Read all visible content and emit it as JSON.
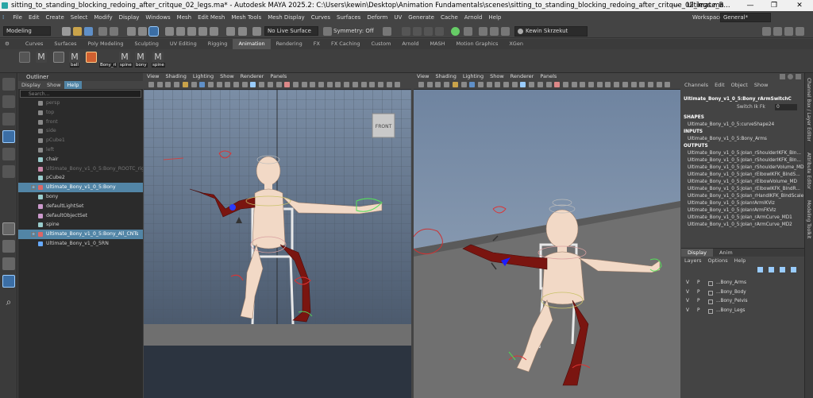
{
  "window": {
    "title": "sitting_to_standing_blocking_redoing_after_critque_02_legs.ma* - Autodesk MAYA 2025.2: C:\\Users\\kewin\\Desktop\\Animation Fundamentals\\scenes\\sitting_to_standing_blocking_redoing_after_critque_02_legs.ma",
    "separator": "---",
    "second_title": "Ultimate_B...",
    "minimize": "—",
    "maximize": "❐",
    "close": "✕"
  },
  "menubar": [
    "File",
    "Edit",
    "Create",
    "Select",
    "Modify",
    "Display",
    "Windows",
    "Mesh",
    "Edit Mesh",
    "Mesh Tools",
    "Mesh Display",
    "Curves",
    "Surfaces",
    "Deform",
    "UV",
    "Generate",
    "Cache",
    "Arnold",
    "Help"
  ],
  "workspace": {
    "label": "Workspace:",
    "value": "General*"
  },
  "statusline": {
    "mode": "Modeling",
    "live_surface": "No Live Surface",
    "symmetry": "Symmetry: Off",
    "user": "Kewin Skrzekut"
  },
  "shelf": {
    "tabs": [
      "Curves",
      "Surfaces",
      "Poly Modeling",
      "Sculpting",
      "UV Editing",
      "Rigging",
      "Animation",
      "Rendering",
      "FX",
      "FX Caching",
      "Custom",
      "Arnold",
      "MASH",
      "Motion Graphics",
      "XGen"
    ],
    "active_tab": "Animation",
    "buttons": [
      "ball",
      "Bony_ri",
      "spine",
      "bony",
      "spine"
    ]
  },
  "outliner": {
    "title": "Outliner",
    "menu": [
      "Display",
      "Show",
      "Help"
    ],
    "search_placeholder": "Search...",
    "items": [
      {
        "label": "persp",
        "dim": true
      },
      {
        "label": "top",
        "dim": true
      },
      {
        "label": "front",
        "dim": true
      },
      {
        "label": "side",
        "dim": true
      },
      {
        "label": "pCube1",
        "dim": true
      },
      {
        "label": "left",
        "dim": true
      },
      {
        "label": "chair",
        "dim": false
      },
      {
        "label": "Ultimate_Bony_v1_0_5:Bony_ROOTC_rig",
        "dim": true
      },
      {
        "label": "pCube2",
        "dim": false
      },
      {
        "label": "Ultimate_Bony_v1_0_5:Bony",
        "dim": false,
        "selected": true
      },
      {
        "label": "bony",
        "dim": false
      },
      {
        "label": "defaultLightSet",
        "dim": false
      },
      {
        "label": "defaultObjectSet",
        "dim": false
      },
      {
        "label": "spine",
        "dim": false
      },
      {
        "label": "Ultimate_Bony_v1_0_5:Bony_All_CNTs",
        "dim": false,
        "selected": true
      },
      {
        "label": "Ultimate_Bony_v1_0_5RN",
        "dim": false
      }
    ]
  },
  "viewport_menu": [
    "View",
    "Shading",
    "Lighting",
    "Show",
    "Renderer",
    "Panels"
  ],
  "viewcube_label": "FRONT",
  "channelbox": {
    "menu": [
      "Channels",
      "Edit",
      "Object",
      "Show"
    ],
    "node": "Ultimate_Bony_v1_0_5:Bony_rArmSwitchC",
    "attr_label": "Switch Ik Fk",
    "attr_value": "0",
    "shapes_label": "SHAPES",
    "shape": "Ultimate_Bony_v1_0_5:curveShape24",
    "inputs_label": "INPUTS",
    "input": "Ultimate_Bony_v1_0_5:Bony_Arms",
    "outputs_label": "OUTPUTS",
    "outputs": [
      "Ultimate_Bony_v1_0_5:Jolan_rShoulderIKFK_Bln...",
      "Ultimate_Bony_v1_0_5:Jolan_rShoulderIKFK_Bln...",
      "Ultimate_Bony_v1_0_5:Jolan_rShoulderVolume_MD",
      "Ultimate_Bony_v1_0_5:Jolan_rElbowIKFK_BlndS...",
      "Ultimate_Bony_v1_0_5:Jolan_rElbowVolume_MD",
      "Ultimate_Bony_v1_0_5:Jolan_rElbowIKFK_BlndR...",
      "Ultimate_Bony_v1_0_5:Jolan_rHandIKFK_BlndScale",
      "Ultimate_Bony_v1_0_5:JolanrArmIKViz",
      "Ultimate_Bony_v1_0_5:JolanrArmFKViz",
      "Ultimate_Bony_v1_0_5:Jolan_rArmCurve_MD1",
      "Ultimate_Bony_v1_0_5:Jolan_rArmCurve_MD2"
    ]
  },
  "layers": {
    "tabs": [
      "Display",
      "Anim"
    ],
    "menu": [
      "Layers",
      "Options",
      "Help"
    ],
    "rows": [
      {
        "v": "V",
        "p": "P",
        "name": "...Bony_Arms"
      },
      {
        "v": "V",
        "p": "P",
        "name": "...Bony_Body"
      },
      {
        "v": "V",
        "p": "P",
        "name": "...Bony_Pelvis"
      },
      {
        "v": "V",
        "p": "P",
        "name": "...Bony_Legs"
      }
    ]
  },
  "side_tabs": [
    "Channel Box / Layer Editor",
    "Attribute Editor",
    "Modeling Toolkit"
  ]
}
